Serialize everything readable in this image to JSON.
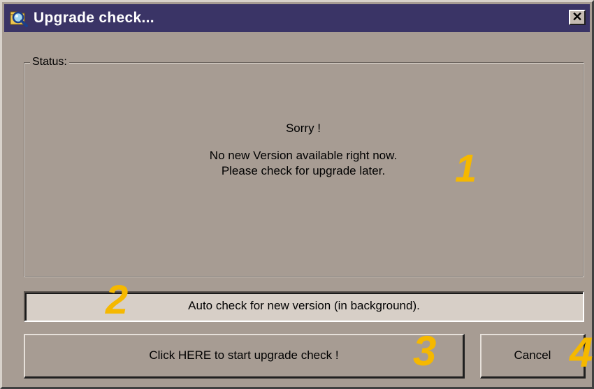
{
  "window": {
    "title": "Upgrade check...",
    "close_symbol": "✕"
  },
  "status_group": {
    "legend": "Status:",
    "message_heading": "Sorry !",
    "message_line_1": "No new Version available right now.",
    "message_line_2": "Please check for upgrade later."
  },
  "auto_check": {
    "label": "Auto check for new version (in background)."
  },
  "buttons": {
    "start_label": "Click HERE to start upgrade check !",
    "cancel_label": "Cancel"
  },
  "annotations": {
    "badge_1": "1",
    "badge_2": "2",
    "badge_3": "3",
    "badge_4": "4"
  },
  "icons": {
    "title_icon": "magnifier-folder-icon",
    "close_icon": "close-icon"
  },
  "colors": {
    "titlebar": "#3a3466",
    "window_face": "#a79c93",
    "annotation": "#f5b800"
  }
}
